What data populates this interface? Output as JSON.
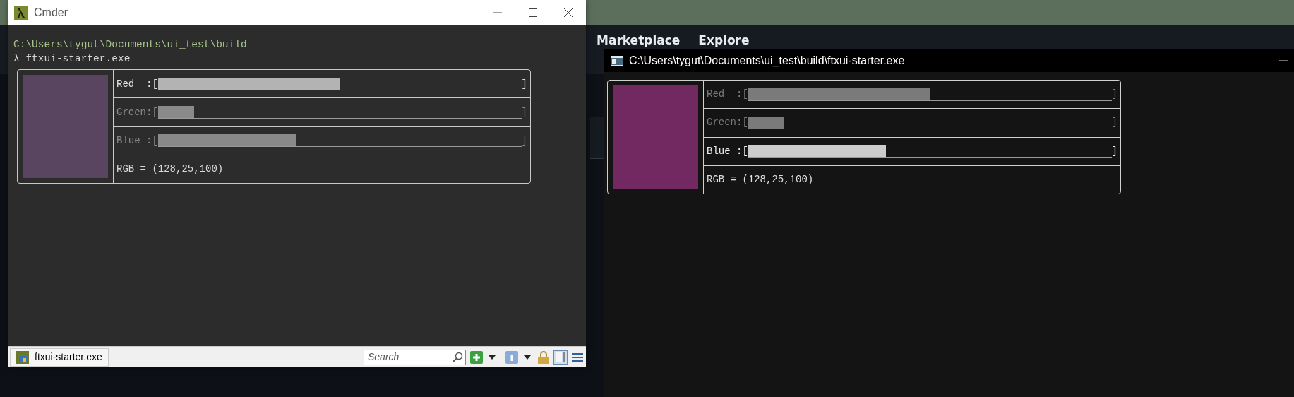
{
  "background_page": {
    "nav": [
      "Marketplace",
      "Explore"
    ]
  },
  "cmder": {
    "title": "Cmder",
    "lines": [
      {
        "kind": "path",
        "text": "C:\\Users\\tygut\\Documents\\ui_test\\build"
      },
      {
        "kind": "command",
        "text": "λ ftxui-starter.exe"
      }
    ],
    "tui": {
      "sliders": [
        {
          "label": "Red  :[",
          "end": "]",
          "level": 0.5,
          "selected": true
        },
        {
          "label": "Green:[",
          "end": "]",
          "level": 0.1,
          "selected": false
        },
        {
          "label": "Blue :[",
          "end": "]",
          "level": 0.38,
          "selected": false
        }
      ],
      "rgb": "RGB = (128,25,100)"
    },
    "status_bar": {
      "tab": "ftxui-starter.exe",
      "search_placeholder": "Search"
    }
  },
  "console": {
    "title": "C:\\Users\\tygut\\Documents\\ui_test\\build\\ftxui-starter.exe",
    "tui": {
      "sliders": [
        {
          "label": "Red  :[",
          "end": "]",
          "level": 0.5,
          "selected": false
        },
        {
          "label": "Green:[",
          "end": "]",
          "level": 0.1,
          "selected": false
        },
        {
          "label": "Blue :[",
          "end": "]",
          "level": 0.38,
          "selected": true
        }
      ],
      "rgb": "RGB = (128,25,100)"
    }
  }
}
